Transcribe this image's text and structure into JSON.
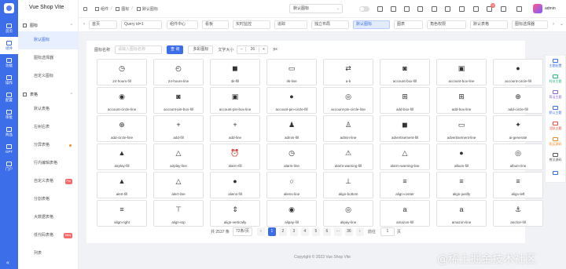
{
  "app": {
    "title": "Vue Shop Vite",
    "copyright": "Copyright © 2023 Vue Shop Vite"
  },
  "rail": [
    {
      "label": "首页",
      "icon": "home-icon",
      "active": false
    },
    {
      "label": "组件",
      "icon": "component-icon",
      "active": true
    },
    {
      "label": "功能",
      "icon": "function-icon",
      "active": false
    },
    {
      "label": "操作",
      "icon": "operate-icon",
      "active": false
    },
    {
      "label": "配置",
      "icon": "config-icon",
      "active": false
    },
    {
      "label": "审批",
      "icon": "approve-icon",
      "active": false
    },
    {
      "label": "商品",
      "icon": "goods-icon",
      "active": false
    },
    {
      "label": "GPT",
      "icon": "gpt-icon",
      "active": false
    },
    {
      "label": "门户",
      "icon": "portal-icon",
      "active": false
    }
  ],
  "sidebar": {
    "group1": "图标",
    "group1_items": [
      {
        "label": "默认图标",
        "active": true,
        "badge": "",
        "dot": false
      },
      {
        "label": "图标选择器",
        "active": false,
        "badge": "",
        "dot": false
      },
      {
        "label": "自定义图标",
        "active": false,
        "badge": "",
        "dot": false
      }
    ],
    "group2": "表格",
    "group2_items": [
      {
        "label": "默认表格",
        "active": false,
        "badge": "",
        "dot": false
      },
      {
        "label": "左树右表",
        "active": false,
        "badge": "",
        "dot": false
      },
      {
        "label": "分屏表格",
        "active": false,
        "badge": "",
        "dot": true
      },
      {
        "label": "行内编辑表格",
        "active": false,
        "badge": "",
        "dot": false
      },
      {
        "label": "自定义表格",
        "active": false,
        "badge": "Pro",
        "dot": false
      },
      {
        "label": "分割表格",
        "active": false,
        "badge": "",
        "dot": false
      },
      {
        "label": "大数据表格",
        "active": false,
        "badge": "",
        "dot": false
      },
      {
        "label": "低代码表格",
        "active": false,
        "badge": "New",
        "dot": false
      },
      {
        "label": "列表",
        "active": false,
        "badge": "",
        "dot": false
      }
    ]
  },
  "header": {
    "breadcrumb": [
      "组件",
      "图标",
      "默认图标"
    ],
    "theme_select": "默认图标",
    "notify_count": "12",
    "user": "admin",
    "collapse": "«"
  },
  "tabs": [
    {
      "label": "首页",
      "active": false
    },
    {
      "label": "Query id=1",
      "active": false
    },
    {
      "label": "组件中心",
      "active": false
    },
    {
      "label": "看板",
      "active": false
    },
    {
      "label": "实时监控",
      "active": false
    },
    {
      "label": "追踪",
      "active": false
    },
    {
      "label": "独立布局",
      "active": false
    },
    {
      "label": "默认图标",
      "active": true
    },
    {
      "label": "图表",
      "active": false
    },
    {
      "label": "角色权限",
      "active": false
    },
    {
      "label": "默认表格",
      "active": false
    },
    {
      "label": "图标选择器",
      "active": false
    }
  ],
  "tab_controls": {
    "left": "‹",
    "right": "›",
    "more": "⌄"
  },
  "search": {
    "label": "图标名称",
    "placeholder": "请输入图标名称",
    "query_btn": "查 询",
    "multi_btn": "多彩图标",
    "size_label": "文字大小",
    "size_minus": "−",
    "size_value": "26",
    "size_plus": "+",
    "unit": "px"
  },
  "icons": [
    {
      "name": "24-hours-fill",
      "glyph": "◷"
    },
    {
      "name": "24-hours-line",
      "glyph": "◴"
    },
    {
      "name": "4k-fill",
      "glyph": "◼"
    },
    {
      "name": "4k-line",
      "glyph": "▭"
    },
    {
      "name": "a-b",
      "glyph": "⇄"
    },
    {
      "name": "account-box-fill",
      "glyph": "◙"
    },
    {
      "name": "account-box-line",
      "glyph": "▣"
    },
    {
      "name": "account-circle-fill",
      "glyph": "●"
    },
    {
      "name": "account-circle-line",
      "glyph": "◉"
    },
    {
      "name": "account-pin-box-fill",
      "glyph": "◙"
    },
    {
      "name": "account-pin-box-line",
      "glyph": "▣"
    },
    {
      "name": "account-pin-circle-fill",
      "glyph": "●"
    },
    {
      "name": "account-pin-circle-line",
      "glyph": "◎"
    },
    {
      "name": "add-box-fill",
      "glyph": "⊞"
    },
    {
      "name": "add-box-line",
      "glyph": "⊞"
    },
    {
      "name": "add-circle-fill",
      "glyph": "⊕"
    },
    {
      "name": "add-circle-line",
      "glyph": "⊕"
    },
    {
      "name": "add-fill",
      "glyph": "+"
    },
    {
      "name": "add-line",
      "glyph": "+"
    },
    {
      "name": "admin-fill",
      "glyph": "♟"
    },
    {
      "name": "admin-line",
      "glyph": "♙"
    },
    {
      "name": "advertisement-fill",
      "glyph": "◼"
    },
    {
      "name": "advertisement-line",
      "glyph": "▭"
    },
    {
      "name": "ai-generate",
      "glyph": "✦"
    },
    {
      "name": "airplay-fill",
      "glyph": "▲"
    },
    {
      "name": "airplay-line",
      "glyph": "△"
    },
    {
      "name": "alarm-fill",
      "glyph": "⏰"
    },
    {
      "name": "alarm-line",
      "glyph": "◷"
    },
    {
      "name": "alarm-warning-fill",
      "glyph": "⚠"
    },
    {
      "name": "alarm-warning-line",
      "glyph": "△"
    },
    {
      "name": "album-fill",
      "glyph": "●"
    },
    {
      "name": "album-line",
      "glyph": "◎"
    },
    {
      "name": "alert-fill",
      "glyph": "▲"
    },
    {
      "name": "alert-line",
      "glyph": "△"
    },
    {
      "name": "aliens-fill",
      "glyph": "●"
    },
    {
      "name": "aliens-line",
      "glyph": "○"
    },
    {
      "name": "align-bottom",
      "glyph": "⊥"
    },
    {
      "name": "align-center",
      "glyph": "≡"
    },
    {
      "name": "align-justify",
      "glyph": "≡"
    },
    {
      "name": "align-left",
      "glyph": "≡"
    },
    {
      "name": "align-right",
      "glyph": "≡"
    },
    {
      "name": "align-top",
      "glyph": "⊤"
    },
    {
      "name": "align-vertically",
      "glyph": "⇕"
    },
    {
      "name": "alipay-fill",
      "glyph": "◉"
    },
    {
      "name": "alipay-line",
      "glyph": "◎"
    },
    {
      "name": "amazon-fill",
      "glyph": "a"
    },
    {
      "name": "amazon-line",
      "glyph": "a"
    },
    {
      "name": "anchor-fill",
      "glyph": "⚓"
    }
  ],
  "pager": {
    "total": "共 2537 条",
    "size": "72条/页",
    "prev": "‹",
    "pages": [
      "1",
      "2",
      "3",
      "4",
      "5",
      "6",
      "···",
      "36"
    ],
    "active": "1",
    "next": "›",
    "goto": "前往",
    "goto_value": "1",
    "page_unit": "页"
  },
  "right_panel": [
    {
      "label": "主题配置",
      "color": "#3d6ee9"
    },
    {
      "label": "科技主题",
      "color": "#2bb673"
    },
    {
      "label": "简洁主题",
      "color": "#8a63d2"
    },
    {
      "label": "默认主题",
      "color": "#3d6ee9"
    },
    {
      "label": "活跃主题",
      "color": "#e74c3c"
    },
    {
      "label": "购买源码",
      "color": "#f08c2a"
    },
    {
      "label": "拷贝源码",
      "color": "#555555"
    },
    {
      "label": "",
      "color": "#3d6ee9"
    }
  ],
  "watermark": "@稀土掘金技术社区"
}
